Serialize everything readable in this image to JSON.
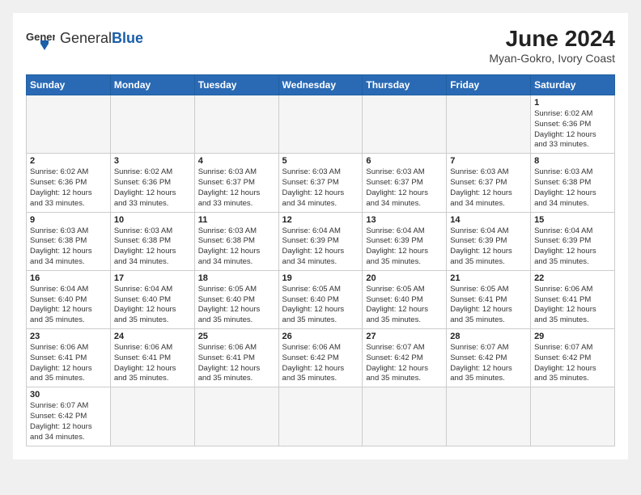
{
  "header": {
    "logo_general": "General",
    "logo_blue": "Blue",
    "title": "June 2024",
    "subtitle": "Myan-Gokro, Ivory Coast"
  },
  "days_of_week": [
    "Sunday",
    "Monday",
    "Tuesday",
    "Wednesday",
    "Thursday",
    "Friday",
    "Saturday"
  ],
  "weeks": [
    [
      {
        "day": null,
        "info": null
      },
      {
        "day": null,
        "info": null
      },
      {
        "day": null,
        "info": null
      },
      {
        "day": null,
        "info": null
      },
      {
        "day": null,
        "info": null
      },
      {
        "day": null,
        "info": null
      },
      {
        "day": "1",
        "info": "Sunrise: 6:02 AM\nSunset: 6:36 PM\nDaylight: 12 hours and 33 minutes."
      }
    ],
    [
      {
        "day": "2",
        "info": "Sunrise: 6:02 AM\nSunset: 6:36 PM\nDaylight: 12 hours and 33 minutes."
      },
      {
        "day": "3",
        "info": "Sunrise: 6:02 AM\nSunset: 6:36 PM\nDaylight: 12 hours and 33 minutes."
      },
      {
        "day": "4",
        "info": "Sunrise: 6:03 AM\nSunset: 6:37 PM\nDaylight: 12 hours and 33 minutes."
      },
      {
        "day": "5",
        "info": "Sunrise: 6:03 AM\nSunset: 6:37 PM\nDaylight: 12 hours and 34 minutes."
      },
      {
        "day": "6",
        "info": "Sunrise: 6:03 AM\nSunset: 6:37 PM\nDaylight: 12 hours and 34 minutes."
      },
      {
        "day": "7",
        "info": "Sunrise: 6:03 AM\nSunset: 6:37 PM\nDaylight: 12 hours and 34 minutes."
      },
      {
        "day": "8",
        "info": "Sunrise: 6:03 AM\nSunset: 6:38 PM\nDaylight: 12 hours and 34 minutes."
      }
    ],
    [
      {
        "day": "9",
        "info": "Sunrise: 6:03 AM\nSunset: 6:38 PM\nDaylight: 12 hours and 34 minutes."
      },
      {
        "day": "10",
        "info": "Sunrise: 6:03 AM\nSunset: 6:38 PM\nDaylight: 12 hours and 34 minutes."
      },
      {
        "day": "11",
        "info": "Sunrise: 6:03 AM\nSunset: 6:38 PM\nDaylight: 12 hours and 34 minutes."
      },
      {
        "day": "12",
        "info": "Sunrise: 6:04 AM\nSunset: 6:39 PM\nDaylight: 12 hours and 34 minutes."
      },
      {
        "day": "13",
        "info": "Sunrise: 6:04 AM\nSunset: 6:39 PM\nDaylight: 12 hours and 35 minutes."
      },
      {
        "day": "14",
        "info": "Sunrise: 6:04 AM\nSunset: 6:39 PM\nDaylight: 12 hours and 35 minutes."
      },
      {
        "day": "15",
        "info": "Sunrise: 6:04 AM\nSunset: 6:39 PM\nDaylight: 12 hours and 35 minutes."
      }
    ],
    [
      {
        "day": "16",
        "info": "Sunrise: 6:04 AM\nSunset: 6:40 PM\nDaylight: 12 hours and 35 minutes."
      },
      {
        "day": "17",
        "info": "Sunrise: 6:04 AM\nSunset: 6:40 PM\nDaylight: 12 hours and 35 minutes."
      },
      {
        "day": "18",
        "info": "Sunrise: 6:05 AM\nSunset: 6:40 PM\nDaylight: 12 hours and 35 minutes."
      },
      {
        "day": "19",
        "info": "Sunrise: 6:05 AM\nSunset: 6:40 PM\nDaylight: 12 hours and 35 minutes."
      },
      {
        "day": "20",
        "info": "Sunrise: 6:05 AM\nSunset: 6:40 PM\nDaylight: 12 hours and 35 minutes."
      },
      {
        "day": "21",
        "info": "Sunrise: 6:05 AM\nSunset: 6:41 PM\nDaylight: 12 hours and 35 minutes."
      },
      {
        "day": "22",
        "info": "Sunrise: 6:06 AM\nSunset: 6:41 PM\nDaylight: 12 hours and 35 minutes."
      }
    ],
    [
      {
        "day": "23",
        "info": "Sunrise: 6:06 AM\nSunset: 6:41 PM\nDaylight: 12 hours and 35 minutes."
      },
      {
        "day": "24",
        "info": "Sunrise: 6:06 AM\nSunset: 6:41 PM\nDaylight: 12 hours and 35 minutes."
      },
      {
        "day": "25",
        "info": "Sunrise: 6:06 AM\nSunset: 6:41 PM\nDaylight: 12 hours and 35 minutes."
      },
      {
        "day": "26",
        "info": "Sunrise: 6:06 AM\nSunset: 6:42 PM\nDaylight: 12 hours and 35 minutes."
      },
      {
        "day": "27",
        "info": "Sunrise: 6:07 AM\nSunset: 6:42 PM\nDaylight: 12 hours and 35 minutes."
      },
      {
        "day": "28",
        "info": "Sunrise: 6:07 AM\nSunset: 6:42 PM\nDaylight: 12 hours and 35 minutes."
      },
      {
        "day": "29",
        "info": "Sunrise: 6:07 AM\nSunset: 6:42 PM\nDaylight: 12 hours and 35 minutes."
      }
    ],
    [
      {
        "day": "30",
        "info": "Sunrise: 6:07 AM\nSunset: 6:42 PM\nDaylight: 12 hours and 34 minutes."
      },
      {
        "day": null,
        "info": null
      },
      {
        "day": null,
        "info": null
      },
      {
        "day": null,
        "info": null
      },
      {
        "day": null,
        "info": null
      },
      {
        "day": null,
        "info": null
      },
      {
        "day": null,
        "info": null
      }
    ]
  ]
}
